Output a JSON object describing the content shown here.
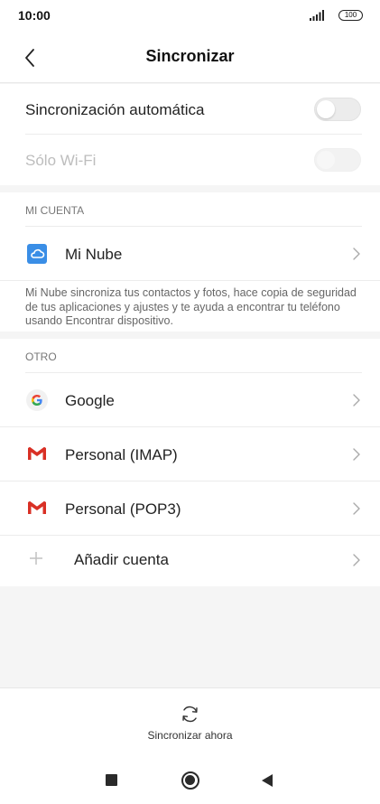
{
  "status_bar": {
    "time": "10:00",
    "battery": "100",
    "icons": [
      "signal-icon",
      "battery-icon"
    ]
  },
  "header": {
    "title": "Sincronizar",
    "back_icon": "chevron-left-icon"
  },
  "settings": {
    "auto_sync": {
      "label": "Sincronización automática",
      "enabled": false
    },
    "wifi_only": {
      "label": "Sólo Wi-Fi",
      "enabled": false,
      "disabled": true
    }
  },
  "my_account": {
    "header": "MI CUENTA",
    "item": {
      "label": "Mi Nube",
      "icon": "cloud-icon",
      "icon_color": "#3a8ee6"
    },
    "description": "Mi Nube sincroniza tus contactos y fotos, hace copia de seguridad de tus aplicaciones y ajustes y te ayuda a encontrar tu teléfono usando Encontrar dispositivo."
  },
  "other": {
    "header": "OTRO",
    "items": [
      {
        "label": "Google",
        "icon": "google-icon"
      },
      {
        "label": "Personal (IMAP)",
        "icon": "gmail-icon",
        "icon_color": "#d93025"
      },
      {
        "label": "Personal (POP3)",
        "icon": "gmail-icon",
        "icon_color": "#d93025"
      },
      {
        "label": "Añadir cuenta",
        "icon": "plus-icon"
      }
    ]
  },
  "bottom": {
    "sync_now_label": "Sincronizar ahora",
    "sync_icon": "sync-icon"
  },
  "nav_bar": {
    "icons": [
      "recent-apps-icon",
      "home-icon",
      "back-icon"
    ]
  }
}
